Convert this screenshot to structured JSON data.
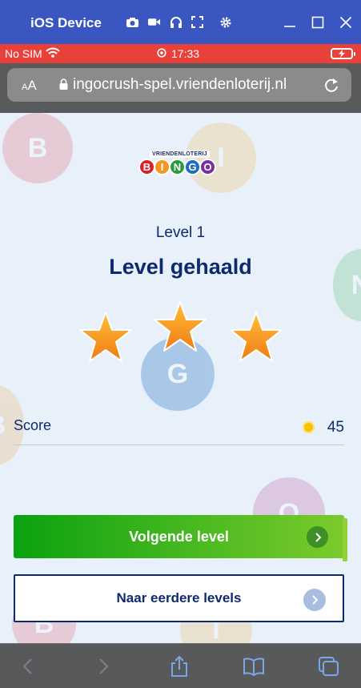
{
  "window": {
    "title": "iOS Device",
    "tools": [
      "camera-icon",
      "video-icon",
      "headphones-icon",
      "fullscreen-icon",
      "gear-icon"
    ],
    "controls": [
      "minimize-icon",
      "maximize-icon",
      "close-icon"
    ]
  },
  "statusbar": {
    "carrier": "No SIM",
    "time": "17:33"
  },
  "addressbar": {
    "text_size_label": "AA",
    "url": "ingocrush-spel.vriendenloterij.nl"
  },
  "logo": {
    "top_text": "VRIENDENLOTERIJ",
    "letters": [
      "B",
      "I",
      "N",
      "G",
      "O"
    ],
    "colors": [
      "#d6212a",
      "#f29a1f",
      "#2a9b3d",
      "#1b6fc1",
      "#7a2f9b"
    ]
  },
  "result": {
    "level_label": "Level 1",
    "title": "Level gehaald",
    "stars_earned": 3,
    "stars_total": 3
  },
  "score": {
    "label": "Score",
    "value": "45"
  },
  "buttons": {
    "next_label": "Volgende level",
    "previous_label": "Naar eerdere levels"
  },
  "colors": {
    "title_bar": "#3a56c0",
    "status_bar": "#e8413a",
    "text_navy": "#0e2a6e",
    "next_green": "#0aa10f",
    "star_orange": "#f7a21b"
  }
}
